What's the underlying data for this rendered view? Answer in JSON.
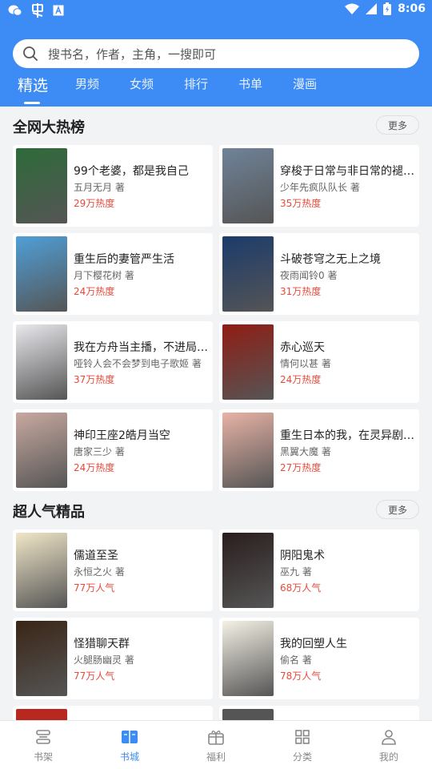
{
  "status_bar": {
    "time": "8:06"
  },
  "search": {
    "placeholder": "搜书名，作者，主角，一搜即可"
  },
  "tabs": [
    {
      "label": "精选",
      "active": true
    },
    {
      "label": "男频"
    },
    {
      "label": "女频"
    },
    {
      "label": "排行"
    },
    {
      "label": "书单"
    },
    {
      "label": "漫画"
    }
  ],
  "sections": [
    {
      "title": "全网大热榜",
      "more_label": "更多",
      "books": [
        {
          "title": "99个老婆，都是我自己",
          "author": "五月无月 著",
          "popularity": "29万热度",
          "cover_color": "#2e6b3a"
        },
        {
          "title": "穿梭于日常与非日常的褪色世界",
          "author": "少年先疯队队长 著",
          "popularity": "35万热度",
          "cover_color": "#6f8399"
        },
        {
          "title": "重生后的妻管严生活",
          "author": "月下樱花树 著",
          "popularity": "24万热度",
          "cover_color": "#4f9fd8"
        },
        {
          "title": "斗破苍穹之无上之境",
          "author": "夜雨闻铃0 著",
          "popularity": "31万热度",
          "cover_color": "#1b3b6b"
        },
        {
          "title": "我在方舟当主播，不进局就能吃饭",
          "author": "哑铃人会不会梦到电子歌姬 著",
          "popularity": "37万热度",
          "cover_color": "#e9e9ee"
        },
        {
          "title": "赤心巡天",
          "author": "情何以甚 著",
          "popularity": "24万热度",
          "cover_color": "#8f1d14"
        },
        {
          "title": "神印王座2皓月当空",
          "author": "唐家三少 著",
          "popularity": "24万热度",
          "cover_color": "#c8a9a0"
        },
        {
          "title": "重生日本的我，在灵异剧本里当主角",
          "author": "黑翼大魔 著",
          "popularity": "27万热度",
          "cover_color": "#e8b3a6"
        }
      ]
    },
    {
      "title": "超人气精品",
      "more_label": "更多",
      "books": [
        {
          "title": "儒道至圣",
          "author": "永恒之火 著",
          "popularity": "77万人气",
          "cover_color": "#f1e6c8"
        },
        {
          "title": "阴阳鬼术",
          "author": "巫九 著",
          "popularity": "68万人气",
          "cover_color": "#2a1e1e"
        },
        {
          "title": "怪猎聊天群",
          "author": "火腿肠幽灵 著",
          "popularity": "77万人气",
          "cover_color": "#3a2516"
        },
        {
          "title": "我的回塑人生",
          "author": "偷名 著",
          "popularity": "78万人气",
          "cover_color": "#f5f1e6"
        }
      ]
    }
  ],
  "bottom_nav": [
    {
      "label": "书架",
      "icon": "bookshelf-icon"
    },
    {
      "label": "书城",
      "icon": "bookstore-icon",
      "active": true
    },
    {
      "label": "福利",
      "icon": "gift-icon"
    },
    {
      "label": "分类",
      "icon": "category-icon"
    },
    {
      "label": "我的",
      "icon": "profile-icon"
    }
  ],
  "colors": {
    "primary": "#3d8bf5",
    "hot_text": "#e84a3a"
  }
}
